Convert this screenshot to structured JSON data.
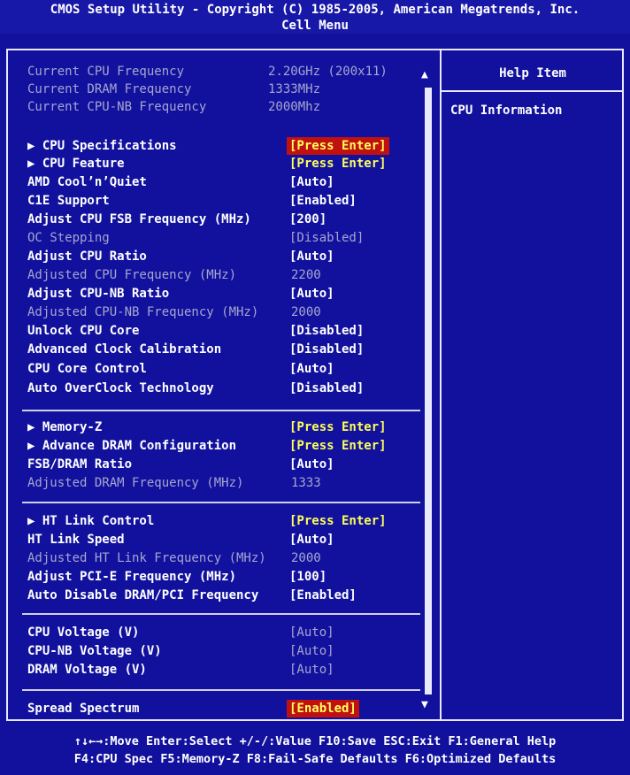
{
  "header": {
    "title": "CMOS Setup Utility - Copyright (C) 1985-2005, American Megatrends, Inc.",
    "subtitle": "Cell Menu"
  },
  "info": [
    {
      "label": "Current CPU Frequency",
      "value": "2.20GHz (200x11)"
    },
    {
      "label": "Current DRAM Frequency",
      "value": "1333MHz"
    },
    {
      "label": "Current CPU-NB Frequency",
      "value": "2000Mhz"
    }
  ],
  "group1": [
    {
      "label": "▶ CPU Specifications",
      "value": "[Press Enter]"
    },
    {
      "label": "▶ CPU Feature",
      "value": "[Press Enter]"
    },
    {
      "label": "AMD Cool’n’Quiet",
      "value": "[Auto]"
    },
    {
      "label": "C1E Support",
      "value": "[Enabled]"
    },
    {
      "label": "Adjust CPU FSB Frequency (MHz)",
      "value": "[200]"
    },
    {
      "label": "OC Stepping",
      "value": "[Disabled]"
    },
    {
      "label": "Adjust CPU Ratio",
      "value": "[Auto]"
    },
    {
      "label": "Adjusted CPU Frequency (MHz)",
      "value": "2200"
    },
    {
      "label": "Adjust CPU-NB Ratio",
      "value": "[Auto]"
    },
    {
      "label": "Adjusted CPU-NB Frequency (MHz)",
      "value": "2000"
    },
    {
      "label": "Unlock CPU Core",
      "value": "[Disabled]"
    },
    {
      "label": "Advanced Clock Calibration",
      "value": "[Disabled]"
    },
    {
      "label": "CPU Core Control",
      "value": "[Auto]"
    },
    {
      "label": "Auto OverClock Technology",
      "value": "[Disabled]"
    }
  ],
  "group2": [
    {
      "label": "▶ Memory-Z",
      "value": "[Press Enter]"
    },
    {
      "label": "▶ Advance DRAM Configuration",
      "value": "[Press Enter]"
    },
    {
      "label": "FSB/DRAM Ratio",
      "value": "[Auto]"
    },
    {
      "label": "Adjusted DRAM Frequency (MHz)",
      "value": "1333"
    }
  ],
  "group3": [
    {
      "label": "▶ HT Link Control",
      "value": "[Press Enter]"
    },
    {
      "label": "HT Link Speed",
      "value": "[Auto]"
    },
    {
      "label": "Adjusted HT Link Frequency (MHz)",
      "value": "2000"
    },
    {
      "label": "Adjust PCI-E Frequency (MHz)",
      "value": "[100]"
    },
    {
      "label": "Auto Disable DRAM/PCI Frequency",
      "value": "[Enabled]"
    }
  ],
  "group4": [
    {
      "label": "CPU Voltage (V)",
      "value": "[Auto]"
    },
    {
      "label": "CPU-NB Voltage (V)",
      "value": "[Auto]"
    },
    {
      "label": "DRAM Voltage (V)",
      "value": "[Auto]"
    }
  ],
  "group5": [
    {
      "label": "Spread Spectrum",
      "value": "[Enabled]"
    }
  ],
  "help": {
    "title": "Help Item",
    "text": "CPU Information"
  },
  "footer": {
    "line1": "↑↓←→:Move  Enter:Select  +/-/:Value  F10:Save  ESC:Exit  F1:General Help",
    "line2": "F4:CPU Spec  F5:Memory-Z  F8:Fail-Safe Defaults    F6:Optimized Defaults"
  },
  "colors": {
    "background": "#11119e",
    "selected_bg": "#c01010",
    "highlight_text": "#ffff5a",
    "disabled_text": "#a6a6cf"
  }
}
